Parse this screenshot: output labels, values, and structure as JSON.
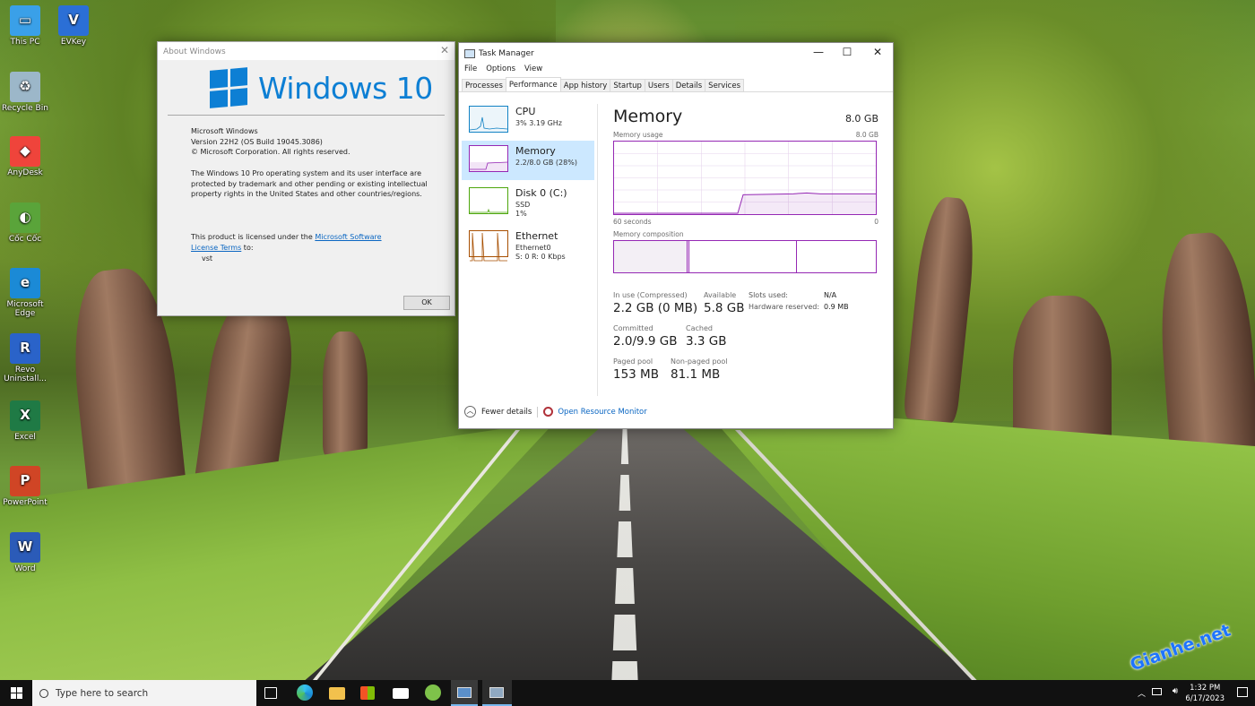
{
  "desktop_icons": [
    {
      "label": "This PC",
      "icon": "computer-icon",
      "color": "#3aa0e8"
    },
    {
      "label": "EVKey",
      "icon": "evkey-icon",
      "color": "#2b6fd6"
    },
    {
      "label": "Recycle Bin",
      "icon": "recycle-bin-icon",
      "color": "#9cb7c9"
    },
    {
      "label": "AnyDesk",
      "icon": "anydesk-icon",
      "color": "#ef443b"
    },
    {
      "label": "Cốc Cốc",
      "icon": "coccoc-icon",
      "color": "#5aa43a"
    },
    {
      "label": "Microsoft Edge",
      "icon": "edge-icon",
      "color": "#1b8ad6"
    },
    {
      "label": "Revo Uninstall...",
      "icon": "revo-icon",
      "color": "#2a63c9"
    },
    {
      "label": "Excel",
      "icon": "excel-icon",
      "color": "#1f7a45"
    },
    {
      "label": "PowerPoint",
      "icon": "powerpoint-icon",
      "color": "#d04525"
    },
    {
      "label": "Word",
      "icon": "word-icon",
      "color": "#2b5bb8"
    }
  ],
  "about": {
    "title": "About Windows",
    "logo_text": "Windows 10",
    "line1": "Microsoft Windows",
    "line2": "Version 22H2 (OS Build 19045.3086)",
    "line3": "© Microsoft Corporation. All rights reserved.",
    "para": "The Windows 10 Pro operating system and its user interface are protected by trademark and other pending or existing intellectual property rights in the United States and other countries/regions.",
    "license_prefix": "This product is licensed under the ",
    "license_link": "Microsoft Software License Terms",
    "license_suffix": " to:",
    "user": "vst",
    "ok": "OK"
  },
  "taskmgr": {
    "title": "Task Manager",
    "menu": [
      "File",
      "Options",
      "View"
    ],
    "tabs": [
      "Processes",
      "Performance",
      "App history",
      "Startup",
      "Users",
      "Details",
      "Services"
    ],
    "active_tab": "Performance",
    "perf_items": [
      {
        "name": "CPU",
        "sub1": "3% 3.19 GHz",
        "sub2": "",
        "color": "#1182c4"
      },
      {
        "name": "Memory",
        "sub1": "2.2/8.0 GB (28%)",
        "sub2": "",
        "color": "#9528b4",
        "selected": true
      },
      {
        "name": "Disk 0 (C:)",
        "sub1": "SSD",
        "sub2": "1%",
        "color": "#4da60c"
      },
      {
        "name": "Ethernet",
        "sub1": "Ethernet0",
        "sub2": "S: 0 R: 0 Kbps",
        "color": "#a74f01"
      }
    ],
    "memory": {
      "heading": "Memory",
      "total": "8.0 GB",
      "usage_label": "Memory usage",
      "usage_max": "8.0 GB",
      "time_label": "60 seconds",
      "time_zero": "0",
      "composition_label": "Memory composition",
      "usage_fraction": 0.28,
      "stats": {
        "in_use_label": "In use (Compressed)",
        "in_use": "2.2 GB (0 MB)",
        "available_label": "Available",
        "available": "5.8 GB",
        "committed_label": "Committed",
        "committed": "2.0/9.9 GB",
        "cached_label": "Cached",
        "cached": "3.3 GB",
        "paged_label": "Paged pool",
        "paged": "153 MB",
        "nonpaged_label": "Non-paged pool",
        "nonpaged": "81.1 MB",
        "slots_label": "Slots used:",
        "slots": "N/A",
        "hw_label": "Hardware reserved:",
        "hw": "0.9 MB"
      }
    },
    "fewer_details": "Fewer details",
    "open_resmon": "Open Resource Monitor"
  },
  "taskbar": {
    "search_placeholder": "Type here to search",
    "time": "1:32 PM",
    "date": "6/17/2023",
    "pinned": [
      "task-view-icon",
      "edge-icon",
      "file-explorer-icon",
      "store-icon",
      "mail-icon",
      "coccoc-icon",
      "task-manager-icon",
      "about-window-icon"
    ]
  },
  "watermark": "Gianhe.net"
}
